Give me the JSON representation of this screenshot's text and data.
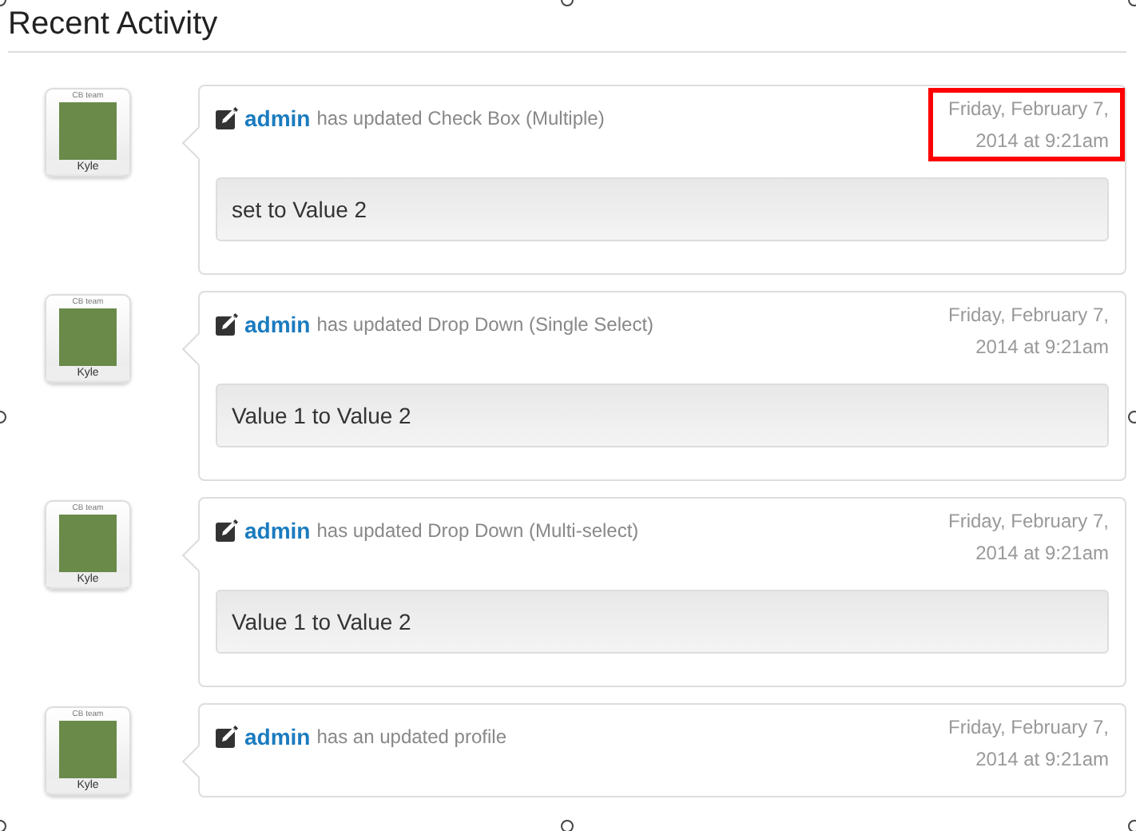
{
  "title": "Recent Activity",
  "activities": [
    {
      "avatar": {
        "badge": "CB team",
        "name": "Kyle"
      },
      "user": "admin",
      "action": "has updated Check Box (Multiple)",
      "date_line1": "Friday, February 7,",
      "date_line2": "2014 at 9:21am",
      "highlighted": true,
      "detail": "set to Value 2"
    },
    {
      "avatar": {
        "badge": "CB team",
        "name": "Kyle"
      },
      "user": "admin",
      "action": "has updated Drop Down (Single Select)",
      "date_line1": "Friday, February 7,",
      "date_line2": "2014 at 9:21am",
      "highlighted": false,
      "detail": "Value 1 to Value 2"
    },
    {
      "avatar": {
        "badge": "CB team",
        "name": "Kyle"
      },
      "user": "admin",
      "action": "has updated Drop Down (Multi-select)",
      "date_line1": "Friday, February 7,",
      "date_line2": "2014 at 9:21am",
      "highlighted": false,
      "detail": "Value 1 to Value 2"
    },
    {
      "avatar": {
        "badge": "CB team",
        "name": "Kyle"
      },
      "user": "admin",
      "action": "has an updated profile",
      "date_line1": "Friday, February 7,",
      "date_line2": "2014 at 9:21am",
      "highlighted": false
    }
  ]
}
